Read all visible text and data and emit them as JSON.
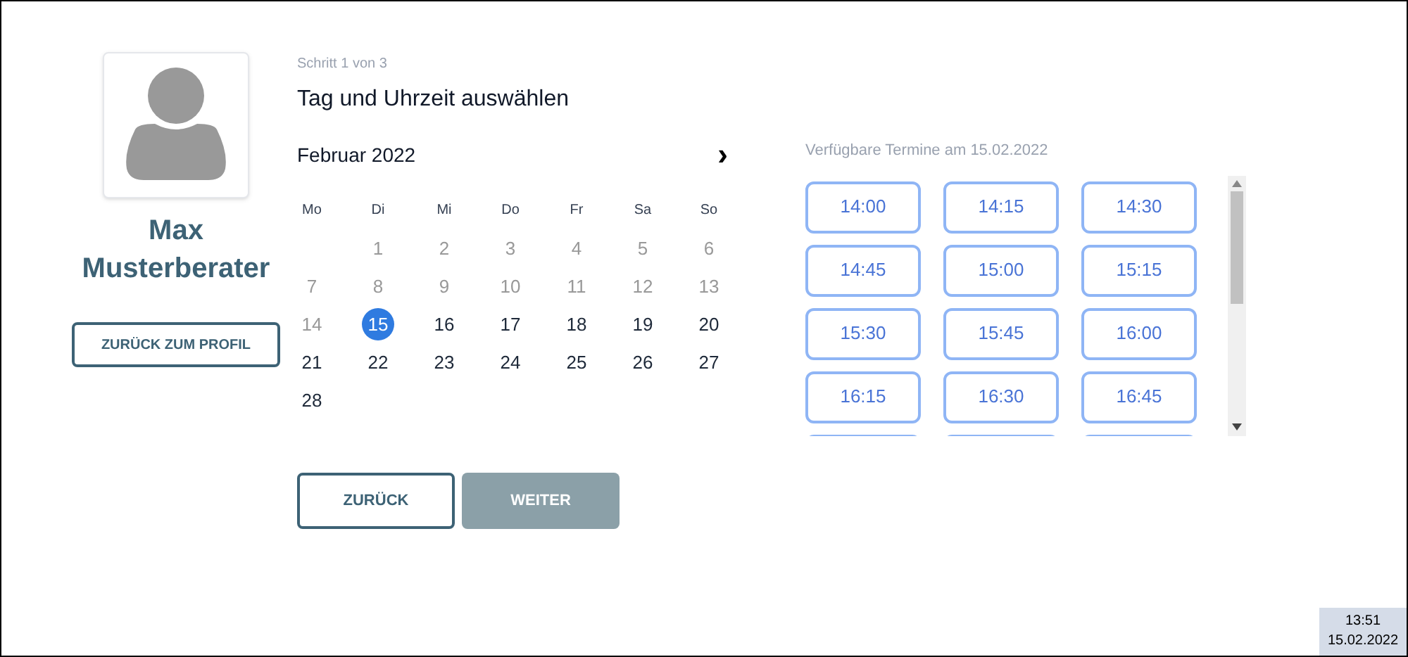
{
  "advisor": {
    "name": "Max Musterberater",
    "back_button": "ZURÜCK ZUM PROFIL"
  },
  "step": "Schritt 1 von 3",
  "title": "Tag und Uhrzeit auswählen",
  "calendar": {
    "month": "Februar 2022",
    "next": "›",
    "weekdays": [
      "Mo",
      "Di",
      "Mi",
      "Do",
      "Fr",
      "Sa",
      "So"
    ],
    "days": [
      {
        "label": "1",
        "disabled": true,
        "selected": false
      },
      {
        "label": "2",
        "disabled": true,
        "selected": false
      },
      {
        "label": "3",
        "disabled": true,
        "selected": false
      },
      {
        "label": "4",
        "disabled": true,
        "selected": false
      },
      {
        "label": "5",
        "disabled": true,
        "selected": false
      },
      {
        "label": "6",
        "disabled": true,
        "selected": false
      },
      {
        "label": "7",
        "disabled": true,
        "selected": false
      },
      {
        "label": "8",
        "disabled": true,
        "selected": false
      },
      {
        "label": "9",
        "disabled": true,
        "selected": false
      },
      {
        "label": "10",
        "disabled": true,
        "selected": false
      },
      {
        "label": "11",
        "disabled": true,
        "selected": false
      },
      {
        "label": "12",
        "disabled": true,
        "selected": false
      },
      {
        "label": "13",
        "disabled": true,
        "selected": false
      },
      {
        "label": "14",
        "disabled": true,
        "selected": false
      },
      {
        "label": "15",
        "disabled": false,
        "selected": true
      },
      {
        "label": "16",
        "disabled": false,
        "selected": false
      },
      {
        "label": "17",
        "disabled": false,
        "selected": false
      },
      {
        "label": "18",
        "disabled": false,
        "selected": false
      },
      {
        "label": "19",
        "disabled": false,
        "selected": false
      },
      {
        "label": "20",
        "disabled": false,
        "selected": false
      },
      {
        "label": "21",
        "disabled": false,
        "selected": false
      },
      {
        "label": "22",
        "disabled": false,
        "selected": false
      },
      {
        "label": "23",
        "disabled": false,
        "selected": false
      },
      {
        "label": "24",
        "disabled": false,
        "selected": false
      },
      {
        "label": "25",
        "disabled": false,
        "selected": false
      },
      {
        "label": "26",
        "disabled": false,
        "selected": false
      },
      {
        "label": "27",
        "disabled": false,
        "selected": false
      },
      {
        "label": "28",
        "disabled": false,
        "selected": false
      }
    ]
  },
  "slots": {
    "heading": "Verfügbare Termine am 15.02.2022",
    "times": [
      {
        "kind": "time",
        "label": "14:00"
      },
      {
        "kind": "time",
        "label": "14:15"
      },
      {
        "kind": "time",
        "label": "14:30"
      },
      {
        "kind": "time",
        "label": "14:45"
      },
      {
        "kind": "time",
        "label": "15:00"
      },
      {
        "kind": "time",
        "label": "15:15"
      },
      {
        "kind": "time",
        "label": "15:30"
      },
      {
        "kind": "time",
        "label": "15:45"
      },
      {
        "kind": "time",
        "label": "16:00"
      },
      {
        "kind": "time",
        "label": "16:15"
      },
      {
        "kind": "time",
        "label": "16:30"
      },
      {
        "kind": "time",
        "label": "16:45"
      },
      {
        "kind": "cut"
      },
      {
        "kind": "cut"
      },
      {
        "kind": "cut"
      }
    ]
  },
  "buttons": [
    {
      "label": "ZURÜCK",
      "disabled": false
    },
    {
      "label": "WEITER",
      "disabled": true
    }
  ],
  "taskbar": {
    "time": "13:51",
    "date": "15.02.2022"
  }
}
